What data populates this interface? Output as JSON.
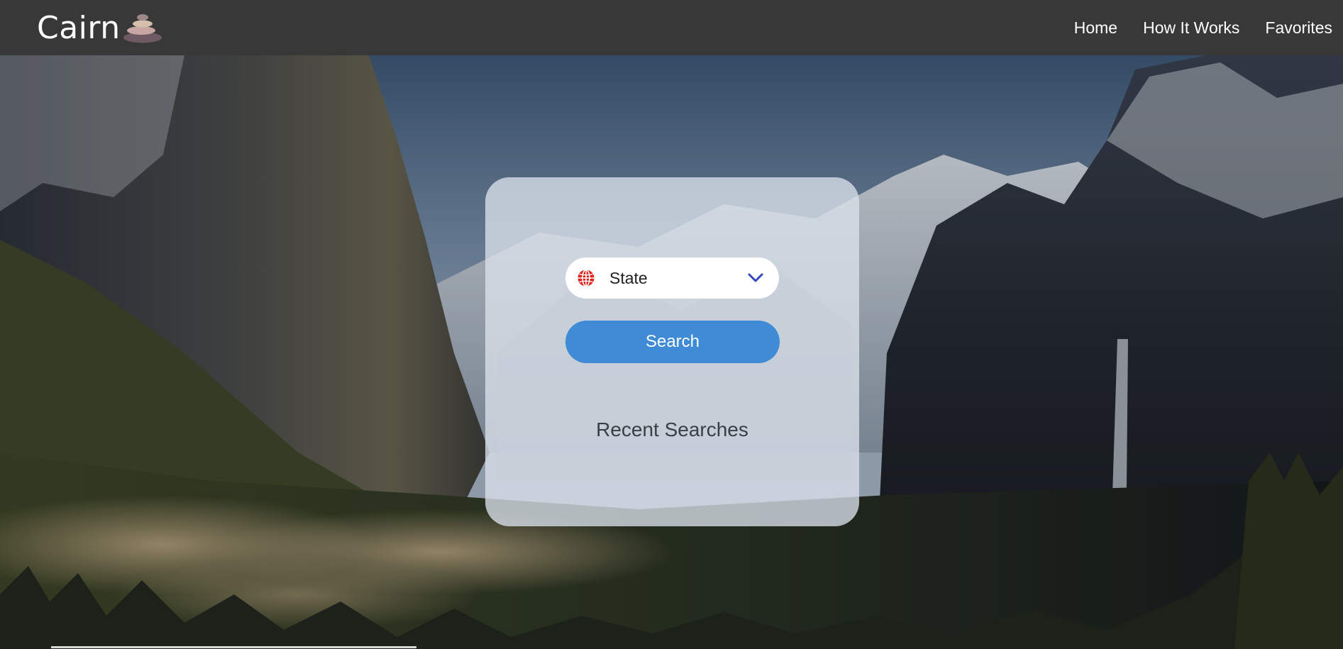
{
  "brand": {
    "name": "Cairn",
    "logo_icon": "stacked-stones-icon"
  },
  "nav": {
    "items": [
      {
        "label": "Home"
      },
      {
        "label": "How It Works"
      },
      {
        "label": "Favorites"
      }
    ]
  },
  "search_card": {
    "state_select": {
      "value": "State",
      "icon": "globe-icon",
      "arrow_icon": "chevron-down-icon"
    },
    "search_button_label": "Search",
    "recent_searches_title": "Recent Searches"
  },
  "colors": {
    "navbar": "#383838",
    "accent_button": "#3f8bd6",
    "globe_red": "#e0221b",
    "chevron_blue": "#3348b8"
  }
}
